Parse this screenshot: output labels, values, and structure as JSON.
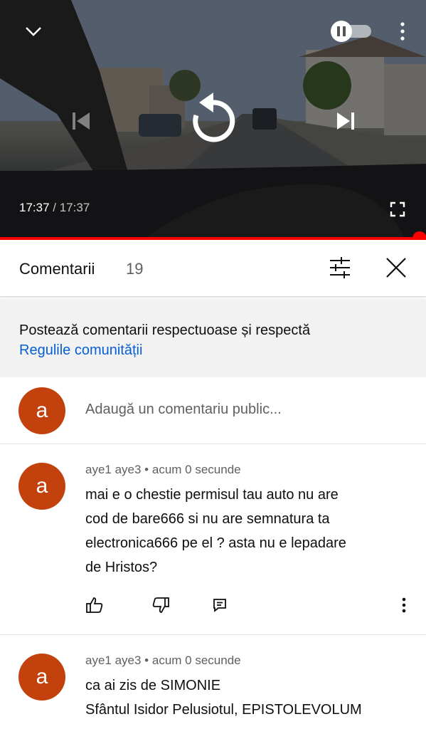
{
  "player": {
    "current_time": "17:37",
    "separator": " / ",
    "duration": "17:37",
    "progress_fraction": 1.0,
    "icons": [
      "collapse-chevron-icon",
      "autoplay-toggle-icon",
      "more-vert-icon",
      "previous-icon",
      "replay-icon",
      "next-icon",
      "fullscreen-icon"
    ]
  },
  "comments_panel": {
    "title": "Comentarii",
    "count": "19",
    "guidelines_text": "Postează comentarii respectuoase și respectă",
    "guidelines_link": "Regulile comunității",
    "add_comment_placeholder": "Adaugă un comentariu public...",
    "user_avatar_letter": "a"
  },
  "comments": [
    {
      "avatar_letter": "a",
      "author": "aye1 aye3",
      "time": "acum 0 secunde",
      "text_lines": [
        "mai e o chestie permisul tau auto nu are",
        "cod de bare666 si nu are semnatura ta",
        "electronica666 pe el ? asta nu e lepadare",
        "de Hristos?"
      ]
    },
    {
      "avatar_letter": "a",
      "author": "aye1 aye3",
      "time": "acum 0 secunde",
      "text_lines": [
        "ca ai zis de SIMONIE",
        "Sfântul Isidor Pelusiotul, EPISTOLEVOLUM"
      ]
    }
  ],
  "colors": {
    "accent_red": "#ff0000",
    "avatar_bg": "#c2410c",
    "link_blue": "#065fd4"
  }
}
